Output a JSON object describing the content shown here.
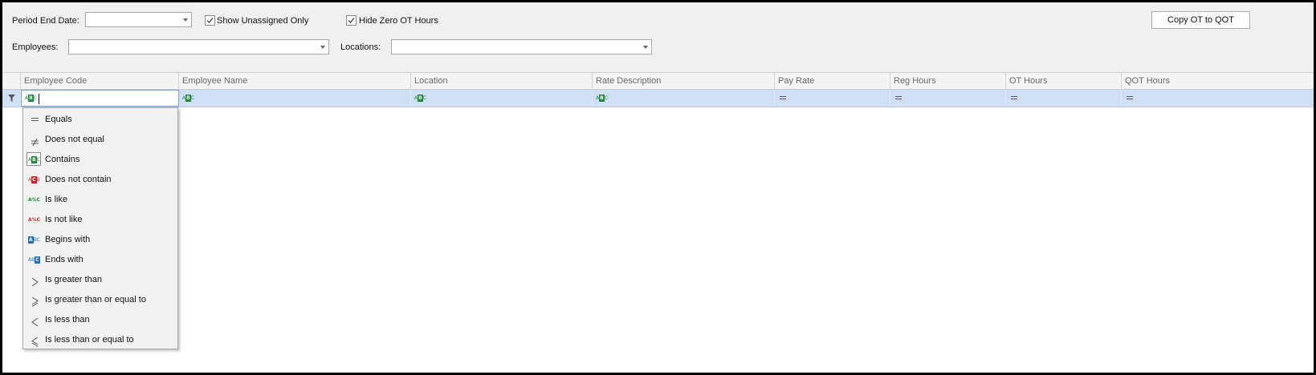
{
  "filters": {
    "period_end_label": "Period End Date:",
    "period_end_value": "",
    "show_unassigned_label": "Show Unassigned Only",
    "show_unassigned_checked": true,
    "hide_zero_label": "Hide Zero OT Hours",
    "hide_zero_checked": true,
    "employees_label": "Employees:",
    "employees_value": "",
    "locations_label": "Locations:",
    "locations_value": "",
    "copy_button": "Copy OT to QOT"
  },
  "grid": {
    "columns": [
      "Employee Code",
      "Employee Name",
      "Location",
      "Rate Description",
      "Pay Rate",
      "Reg Hours",
      "OT Hours",
      "QOT Hours"
    ],
    "filter_row": [
      "contains",
      "contains",
      "contains",
      "contains",
      "equals",
      "equals",
      "equals",
      "equals"
    ],
    "rows": []
  },
  "filter_menu": {
    "items": [
      {
        "label": "Equals",
        "icon": "equals-icon"
      },
      {
        "label": "Does not equal",
        "icon": "not-equal-icon"
      },
      {
        "label": "Contains",
        "icon": "contains-icon",
        "selected": true
      },
      {
        "label": "Does not contain",
        "icon": "does-not-contain-icon"
      },
      {
        "label": "Is like",
        "icon": "is-like-icon"
      },
      {
        "label": "Is not like",
        "icon": "is-not-like-icon"
      },
      {
        "label": "Begins with",
        "icon": "begins-with-icon"
      },
      {
        "label": "Ends with",
        "icon": "ends-with-icon"
      },
      {
        "label": "Is greater than",
        "icon": "greater-than-icon"
      },
      {
        "label": "Is greater than or equal to",
        "icon": "greater-equal-icon"
      },
      {
        "label": "Is less than",
        "icon": "less-than-icon"
      },
      {
        "label": "Is less than or equal to",
        "icon": "less-equal-icon"
      }
    ]
  },
  "colors": {
    "filter_row_bg": "#cfdff5",
    "abc_green": "#1e8a3c",
    "abc_red": "#c8262b",
    "abc_blue": "#1f6fc1"
  }
}
